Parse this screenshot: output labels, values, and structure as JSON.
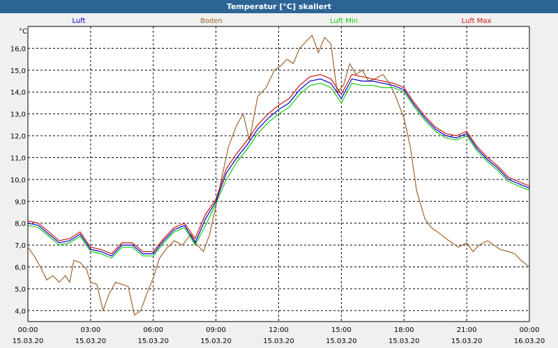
{
  "title": "Temperatur [°C] skaliert",
  "chart_data": {
    "type": "line",
    "title": "Temperatur [°C] skaliert",
    "ylabel": "°C",
    "xlabel": "",
    "ylim": [
      3.5,
      17.0
    ],
    "xlim": [
      0,
      24
    ],
    "grid": true,
    "legend": "top",
    "y_ticks": [
      {
        "v": 4,
        "label": "4,0"
      },
      {
        "v": 5,
        "label": "5,0"
      },
      {
        "v": 6,
        "label": "6,0"
      },
      {
        "v": 7,
        "label": "7,0"
      },
      {
        "v": 8,
        "label": "8,0"
      },
      {
        "v": 9,
        "label": "9,0"
      },
      {
        "v": 10,
        "label": "10,0"
      },
      {
        "v": 11,
        "label": "11,0"
      },
      {
        "v": 12,
        "label": "12,0"
      },
      {
        "v": 13,
        "label": "13,0"
      },
      {
        "v": 14,
        "label": "14,0"
      },
      {
        "v": 15,
        "label": "15,0"
      },
      {
        "v": 16,
        "label": "16,0"
      }
    ],
    "x_ticks": [
      {
        "v": 0,
        "time": "00:00",
        "date": "15.03.20"
      },
      {
        "v": 3,
        "time": "03:00",
        "date": "15.03.20"
      },
      {
        "v": 6,
        "time": "06:00",
        "date": "15.03.20"
      },
      {
        "v": 9,
        "time": "09:00",
        "date": "15.03.20"
      },
      {
        "v": 12,
        "time": "12:00",
        "date": "15.03.20"
      },
      {
        "v": 15,
        "time": "15:00",
        "date": "15.03.20"
      },
      {
        "v": 18,
        "time": "18:00",
        "date": "15.03.20"
      },
      {
        "v": 21,
        "time": "21:00",
        "date": "15.03.20"
      },
      {
        "v": 24,
        "time": "00:00",
        "date": "16.03.20"
      }
    ],
    "series": [
      {
        "name": "Luft",
        "color": "#0000c8",
        "points": [
          [
            0,
            8.0
          ],
          [
            0.5,
            7.9
          ],
          [
            1.0,
            7.5
          ],
          [
            1.5,
            7.1
          ],
          [
            2.0,
            7.2
          ],
          [
            2.5,
            7.5
          ],
          [
            3.0,
            6.8
          ],
          [
            3.5,
            6.7
          ],
          [
            4.0,
            6.5
          ],
          [
            4.5,
            7.0
          ],
          [
            5.0,
            7.0
          ],
          [
            5.5,
            6.6
          ],
          [
            6.0,
            6.6
          ],
          [
            6.5,
            7.2
          ],
          [
            7.0,
            7.7
          ],
          [
            7.5,
            7.9
          ],
          [
            8.0,
            7.1
          ],
          [
            8.5,
            8.2
          ],
          [
            9.0,
            9.0
          ],
          [
            9.5,
            10.3
          ],
          [
            10.0,
            11.0
          ],
          [
            10.5,
            11.6
          ],
          [
            11.0,
            12.3
          ],
          [
            11.5,
            12.8
          ],
          [
            12.0,
            13.2
          ],
          [
            12.5,
            13.5
          ],
          [
            13.0,
            14.1
          ],
          [
            13.5,
            14.5
          ],
          [
            14.0,
            14.6
          ],
          [
            14.5,
            14.4
          ],
          [
            15.0,
            13.7
          ],
          [
            15.5,
            14.6
          ],
          [
            16.0,
            14.5
          ],
          [
            16.5,
            14.5
          ],
          [
            17.0,
            14.4
          ],
          [
            17.5,
            14.3
          ],
          [
            18.0,
            14.1
          ],
          [
            18.5,
            13.4
          ],
          [
            19.0,
            12.8
          ],
          [
            19.5,
            12.3
          ],
          [
            20.0,
            12.0
          ],
          [
            20.5,
            11.9
          ],
          [
            21.0,
            12.1
          ],
          [
            21.5,
            11.4
          ],
          [
            22.0,
            10.9
          ],
          [
            22.5,
            10.5
          ],
          [
            23.0,
            10.0
          ],
          [
            23.5,
            9.8
          ],
          [
            24.0,
            9.6
          ]
        ]
      },
      {
        "name": "Boden",
        "color": "#a0642a",
        "points": [
          [
            0,
            6.9
          ],
          [
            0.3,
            6.5
          ],
          [
            0.6,
            6.0
          ],
          [
            0.9,
            5.4
          ],
          [
            1.2,
            5.6
          ],
          [
            1.5,
            5.3
          ],
          [
            1.8,
            5.6
          ],
          [
            2.0,
            5.3
          ],
          [
            2.2,
            6.3
          ],
          [
            2.5,
            6.2
          ],
          [
            2.8,
            5.9
          ],
          [
            3.0,
            5.3
          ],
          [
            3.3,
            5.2
          ],
          [
            3.6,
            4.0
          ],
          [
            3.9,
            4.8
          ],
          [
            4.2,
            5.3
          ],
          [
            4.5,
            5.2
          ],
          [
            4.8,
            5.1
          ],
          [
            5.1,
            3.8
          ],
          [
            5.4,
            4.0
          ],
          [
            5.7,
            4.8
          ],
          [
            6.0,
            5.5
          ],
          [
            6.3,
            6.4
          ],
          [
            6.6,
            6.8
          ],
          [
            7.0,
            7.2
          ],
          [
            7.4,
            7.0
          ],
          [
            7.8,
            7.5
          ],
          [
            8.1,
            7.0
          ],
          [
            8.4,
            6.7
          ],
          [
            8.7,
            7.5
          ],
          [
            9.0,
            8.8
          ],
          [
            9.3,
            10.2
          ],
          [
            9.6,
            11.5
          ],
          [
            10.0,
            12.5
          ],
          [
            10.3,
            13.0
          ],
          [
            10.6,
            11.8
          ],
          [
            11.0,
            13.8
          ],
          [
            11.4,
            14.2
          ],
          [
            11.8,
            15.0
          ],
          [
            12.1,
            15.2
          ],
          [
            12.4,
            15.5
          ],
          [
            12.7,
            15.3
          ],
          [
            13.0,
            16.0
          ],
          [
            13.3,
            16.3
          ],
          [
            13.6,
            16.6
          ],
          [
            13.9,
            15.8
          ],
          [
            14.2,
            16.5
          ],
          [
            14.5,
            16.2
          ],
          [
            14.8,
            14.0
          ],
          [
            15.1,
            14.3
          ],
          [
            15.4,
            15.3
          ],
          [
            15.7,
            14.8
          ],
          [
            16.0,
            15.0
          ],
          [
            16.3,
            14.5
          ],
          [
            16.6,
            14.6
          ],
          [
            17.0,
            14.8
          ],
          [
            17.3,
            14.4
          ],
          [
            17.6,
            13.8
          ],
          [
            18.0,
            12.8
          ],
          [
            18.3,
            11.5
          ],
          [
            18.6,
            9.5
          ],
          [
            19.0,
            8.2
          ],
          [
            19.3,
            7.8
          ],
          [
            19.6,
            7.6
          ],
          [
            20.0,
            7.3
          ],
          [
            20.3,
            7.1
          ],
          [
            20.6,
            6.9
          ],
          [
            21.0,
            7.1
          ],
          [
            21.3,
            6.7
          ],
          [
            21.6,
            7.0
          ],
          [
            22.0,
            7.2
          ],
          [
            22.3,
            7.0
          ],
          [
            22.6,
            6.8
          ],
          [
            23.0,
            6.7
          ],
          [
            23.3,
            6.6
          ],
          [
            23.6,
            6.3
          ],
          [
            24.0,
            6.0
          ]
        ]
      },
      {
        "name": "Luft Min",
        "color": "#14c814",
        "points": [
          [
            0,
            7.9
          ],
          [
            0.5,
            7.8
          ],
          [
            1.0,
            7.4
          ],
          [
            1.5,
            7.0
          ],
          [
            2.0,
            7.1
          ],
          [
            2.5,
            7.4
          ],
          [
            3.0,
            6.7
          ],
          [
            3.5,
            6.6
          ],
          [
            4.0,
            6.4
          ],
          [
            4.5,
            6.9
          ],
          [
            5.0,
            6.9
          ],
          [
            5.5,
            6.5
          ],
          [
            6.0,
            6.5
          ],
          [
            6.5,
            7.1
          ],
          [
            7.0,
            7.6
          ],
          [
            7.5,
            7.8
          ],
          [
            8.0,
            7.0
          ],
          [
            8.5,
            7.9
          ],
          [
            9.0,
            8.9
          ],
          [
            9.5,
            10.0
          ],
          [
            10.0,
            10.8
          ],
          [
            10.5,
            11.4
          ],
          [
            11.0,
            12.1
          ],
          [
            11.5,
            12.6
          ],
          [
            12.0,
            13.0
          ],
          [
            12.5,
            13.3
          ],
          [
            13.0,
            13.9
          ],
          [
            13.5,
            14.3
          ],
          [
            14.0,
            14.4
          ],
          [
            14.5,
            14.2
          ],
          [
            15.0,
            13.5
          ],
          [
            15.5,
            14.4
          ],
          [
            16.0,
            14.3
          ],
          [
            16.5,
            14.3
          ],
          [
            17.0,
            14.2
          ],
          [
            17.5,
            14.2
          ],
          [
            18.0,
            14.0
          ],
          [
            18.5,
            13.3
          ],
          [
            19.0,
            12.7
          ],
          [
            19.5,
            12.2
          ],
          [
            20.0,
            11.9
          ],
          [
            20.5,
            11.8
          ],
          [
            21.0,
            12.0
          ],
          [
            21.5,
            11.3
          ],
          [
            22.0,
            10.8
          ],
          [
            22.5,
            10.4
          ],
          [
            23.0,
            9.9
          ],
          [
            23.5,
            9.7
          ],
          [
            24.0,
            9.5
          ]
        ]
      },
      {
        "name": "Luft Max",
        "color": "#c81414",
        "points": [
          [
            0,
            8.1
          ],
          [
            0.5,
            8.0
          ],
          [
            1.0,
            7.6
          ],
          [
            1.5,
            7.2
          ],
          [
            2.0,
            7.3
          ],
          [
            2.5,
            7.6
          ],
          [
            3.0,
            6.9
          ],
          [
            3.5,
            6.8
          ],
          [
            4.0,
            6.6
          ],
          [
            4.5,
            7.1
          ],
          [
            5.0,
            7.1
          ],
          [
            5.5,
            6.7
          ],
          [
            6.0,
            6.7
          ],
          [
            6.5,
            7.3
          ],
          [
            7.0,
            7.8
          ],
          [
            7.5,
            8.0
          ],
          [
            8.0,
            7.3
          ],
          [
            8.5,
            8.4
          ],
          [
            9.0,
            9.1
          ],
          [
            9.5,
            10.5
          ],
          [
            10.0,
            11.2
          ],
          [
            10.5,
            11.8
          ],
          [
            11.0,
            12.5
          ],
          [
            11.5,
            13.0
          ],
          [
            12.0,
            13.4
          ],
          [
            12.5,
            13.7
          ],
          [
            13.0,
            14.3
          ],
          [
            13.5,
            14.7
          ],
          [
            14.0,
            14.8
          ],
          [
            14.5,
            14.6
          ],
          [
            15.0,
            13.9
          ],
          [
            15.5,
            14.8
          ],
          [
            16.0,
            14.7
          ],
          [
            16.5,
            14.6
          ],
          [
            17.0,
            14.5
          ],
          [
            17.5,
            14.4
          ],
          [
            18.0,
            14.2
          ],
          [
            18.5,
            13.5
          ],
          [
            19.0,
            12.9
          ],
          [
            19.5,
            12.4
          ],
          [
            20.0,
            12.1
          ],
          [
            20.5,
            12.0
          ],
          [
            21.0,
            12.2
          ],
          [
            21.5,
            11.5
          ],
          [
            22.0,
            11.0
          ],
          [
            22.5,
            10.6
          ],
          [
            23.0,
            10.1
          ],
          [
            23.5,
            9.9
          ],
          [
            24.0,
            9.7
          ]
        ]
      }
    ]
  }
}
